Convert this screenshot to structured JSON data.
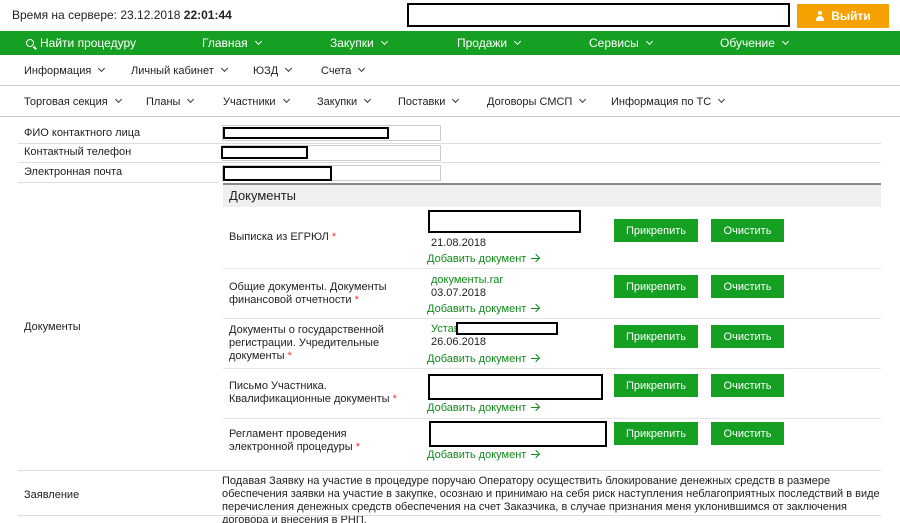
{
  "header": {
    "server_time_label": "Время на сервере:",
    "server_date": "23.12.2018",
    "server_time": "22:01:44",
    "logout_label": "Выйти"
  },
  "main_nav": {
    "search": "Найти процедуру",
    "items": [
      "Главная",
      "Закупки",
      "Продажи",
      "Сервисы",
      "Обучение"
    ]
  },
  "sub_nav_1": [
    "Информация",
    "Личный кабинет",
    "ЮЗД",
    "Счета"
  ],
  "sub_nav_2": [
    "Торговая секция",
    "Планы",
    "Участники",
    "Закупки",
    "Поставки",
    "Договоры СМСП",
    "Информация по ТС"
  ],
  "contact": {
    "name_label": "ФИО контактного лица",
    "phone_label": "Контактный телефон",
    "email_label": "Электронная почта"
  },
  "documents": {
    "section_label": "Документы",
    "header": "Документы",
    "attach_label": "Прикрепить",
    "clear_label": "Очистить",
    "add_label": "Добавить документ",
    "items": [
      {
        "label": "Выписка из ЕГРЮЛ",
        "file": "",
        "date": "21.08.2018"
      },
      {
        "label": "Общие документы. Документы финансовой отчетности",
        "file": "документы.rar",
        "date": "03.07.2018"
      },
      {
        "label": "Документы о государственной регистрации. Учредительные документы",
        "file": "Устав",
        "date": "26.06.2018"
      },
      {
        "label": "Письмо Участника. Квалификационные документы",
        "file": "",
        "date": ""
      },
      {
        "label": "Регламент проведения электронной процедуры",
        "file": "",
        "date": ""
      }
    ]
  },
  "statement": {
    "label": "Заявление",
    "text": "Подавая Заявку на участие в процедуре поручаю Оператору осуществить блокирование денежных средств в размере обеспечения заявки на участие в закупке, осознаю и принимаю на себя риск наступления неблагоприятных последствий в виде перечисления денежных средств обеспечения на счет Заказчика, в случае признания меня уклонившимся от заключения договора и внесения в РНП."
  },
  "colors": {
    "green": "#16a023",
    "orange": "#f5a100",
    "link": "#118a1a",
    "required": "#e33333"
  }
}
